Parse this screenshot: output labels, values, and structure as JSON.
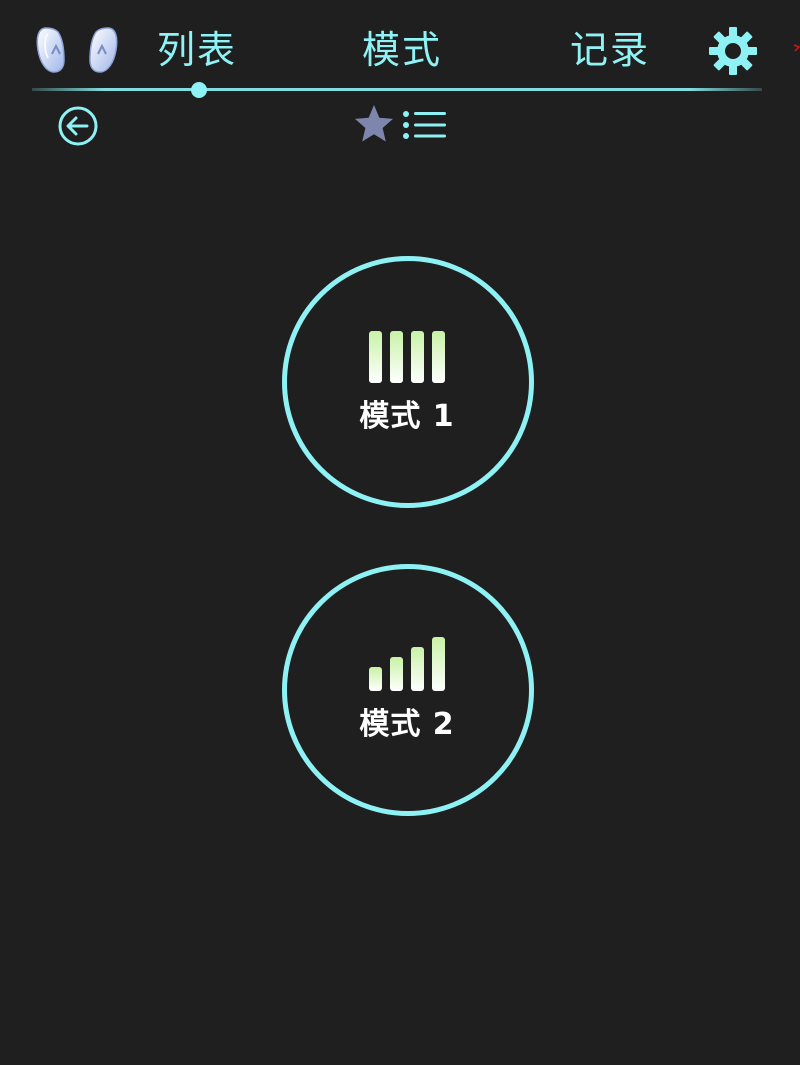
{
  "header": {
    "tabs": [
      {
        "label": "列表",
        "selected": true
      },
      {
        "label": "模式",
        "selected": false
      },
      {
        "label": "记录",
        "selected": false
      }
    ],
    "left_icon": "earbuds-icon",
    "right_icon": "gear-icon"
  },
  "toolbar": {
    "back_icon": "arrow-left-circle-icon",
    "favorite_icon": "star-icon",
    "list_icon": "list-icon"
  },
  "modes": [
    {
      "label": "模式 1",
      "icon": "equal-bars-icon"
    },
    {
      "label": "模式 2",
      "icon": "signal-bars-icon"
    }
  ],
  "colors": {
    "background": "#1f1f1f",
    "accent": "#8ef2f5",
    "star": "#7f86ad",
    "bar_top": "#c8f2a6",
    "bar_bottom": "#ffffff",
    "label": "#ffffff"
  }
}
